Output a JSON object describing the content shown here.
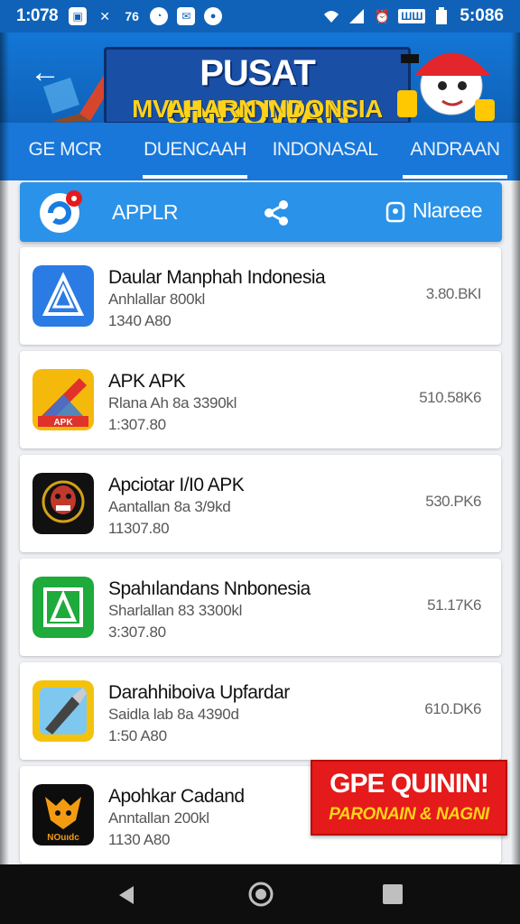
{
  "status_bar": {
    "time": "1:078",
    "right_time": "5:086",
    "tag": "ШШ",
    "icons": [
      "box-icon",
      "x-icon",
      "signal-icon",
      "circle-icon",
      "box-icon",
      "circle-icon",
      "wifi-icon",
      "cellular-icon",
      "alarm-icon",
      "battery-icon"
    ],
    "left_glyph": "76"
  },
  "banner": {
    "title_part1": "PUSAT",
    "title_part2": "UNDOWAN",
    "subtitle": "MVAHARN INDONSIA",
    "back_icon": "back-arrow-icon"
  },
  "tabs": [
    {
      "label": "GE MCR",
      "active": false
    },
    {
      "label": "DUENCAAH",
      "active": true
    },
    {
      "label": "INDONASAL",
      "active": false
    },
    {
      "label": "ANDRAAN",
      "active": true
    }
  ],
  "action_bar": {
    "label": "APPLR",
    "right_label": "Nlareee",
    "share_icon": "share-icon"
  },
  "apps": [
    {
      "name": "Daular Manphah Indonesia",
      "sub": "Anhlallar 800kl",
      "date": "1340 A80",
      "size": "3.80.BKI",
      "icon": "app-triangle-icon",
      "color": "#2a7be4"
    },
    {
      "name": "APK APK",
      "sub": "Rlana Ah 8a 3390kl",
      "date": "1:307.80",
      "size": "510.58K6",
      "icon": "app-apk-icon",
      "color": "#f5b90c"
    },
    {
      "name": "Apciotar I/I0 APK",
      "sub": "Aantallan 8a 3/9kd",
      "date": "11307.80",
      "size": "530.PK6",
      "icon": "app-mask-icon",
      "color": "#111111"
    },
    {
      "name": "Spahılandans Nnbonesia",
      "sub": "Sharlallan 83 3300kl",
      "date": "3:307.80",
      "size": "51.17K6",
      "icon": "app-green-icon",
      "color": "#1faa3c"
    },
    {
      "name": "Darahhiboiva Upfardar",
      "sub": "Saidla lab 8a 4390d",
      "date": "1:50 A80",
      "size": "610.DK6",
      "icon": "app-pen-icon",
      "color": "#f4c20d"
    },
    {
      "name": "Apohkar Cadand",
      "sub": "Anntallan 200kl",
      "date": "1130 A80",
      "size": "",
      "icon": "app-tiger-icon",
      "color": "#0d0d0d"
    }
  ],
  "promo": {
    "line1": "GPE QUININ!",
    "line2": "PARONAIN & NAGNI"
  },
  "tiger_icon_text": "NOuıdc"
}
